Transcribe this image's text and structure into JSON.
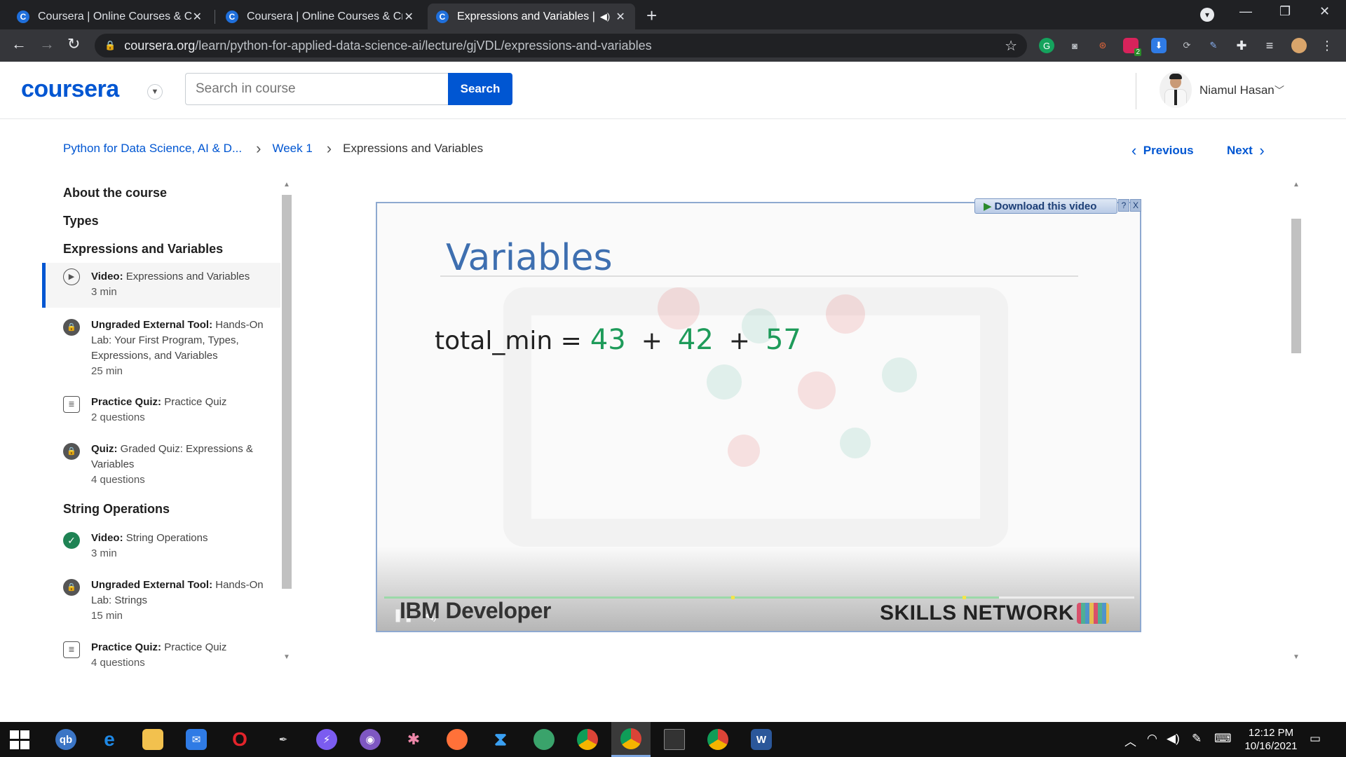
{
  "browser": {
    "tabs": [
      {
        "title": "Coursera | Online Courses & Credentials From Top Educators",
        "favicon": "C",
        "close": "✕"
      },
      {
        "title": "Coursera | Online Courses & Credentials From Top Educators",
        "favicon": "C",
        "close": "✕"
      },
      {
        "title": "Expressions and Variables | Coursera",
        "favicon": "C",
        "close": "✕",
        "active": true
      }
    ],
    "new_tab": "+",
    "url_host": "coursera.org",
    "url_path": "/learn/python-for-applied-data-science-ai/lecture/gjVDL/expressions-and-variables",
    "extension_badge": "2"
  },
  "header": {
    "logo": "coursera",
    "search_placeholder": "Search in course",
    "search_button": "Search",
    "user_name": "Niamul Hasan"
  },
  "breadcrumb": {
    "course": "Python for Data Science, AI & D...",
    "week": "Week 1",
    "current": "Expressions and Variables"
  },
  "pager": {
    "previous": "Previous",
    "next": "Next"
  },
  "sidebar": {
    "sections": [
      {
        "title": "About the course"
      },
      {
        "title": "Types"
      },
      {
        "title": "Expressions and Variables"
      },
      {
        "title": "String Operations"
      }
    ],
    "items": [
      {
        "type": "Video:",
        "name": "Expressions and Variables",
        "meta": "3 min",
        "icon": "play-circle-icon"
      },
      {
        "type": "Ungraded External Tool:",
        "name": "Hands-On Lab: Your First Program, Types, Expressions, and Variables",
        "meta": "25 min",
        "icon": "lock-icon"
      },
      {
        "type": "Practice Quiz:",
        "name": "Practice Quiz",
        "meta": "2 questions",
        "icon": "quiz-icon"
      },
      {
        "type": "Quiz:",
        "name": "Graded Quiz: Expressions & Variables",
        "meta": "4 questions",
        "icon": "lock-icon"
      },
      {
        "type": "Video:",
        "name": "String Operations",
        "meta": "3 min",
        "icon": "checkmark-icon"
      },
      {
        "type": "Ungraded External Tool:",
        "name": "Hands-On Lab: Strings",
        "meta": "15 min",
        "icon": "lock-icon"
      },
      {
        "type": "Practice Quiz:",
        "name": "Practice Quiz",
        "meta": "4 questions",
        "icon": "quiz-icon"
      }
    ]
  },
  "video": {
    "slide_title": "Variables",
    "expression": {
      "lhs": "total_min =",
      "terms": [
        "43",
        "42",
        "57"
      ],
      "operator": "+"
    },
    "progress": 0.82,
    "footer_left": "IBM Developer",
    "footer_right": "SKILLS NETWORK",
    "download_label": "Download this video",
    "download_help": "?",
    "download_close": "X"
  },
  "taskbar": {
    "clock_time": "12:12 PM",
    "clock_date": "10/16/2021"
  },
  "colors": {
    "accent": "#0056d2",
    "number_green": "#1e9b5a",
    "slide_title": "#3e6fb0"
  }
}
